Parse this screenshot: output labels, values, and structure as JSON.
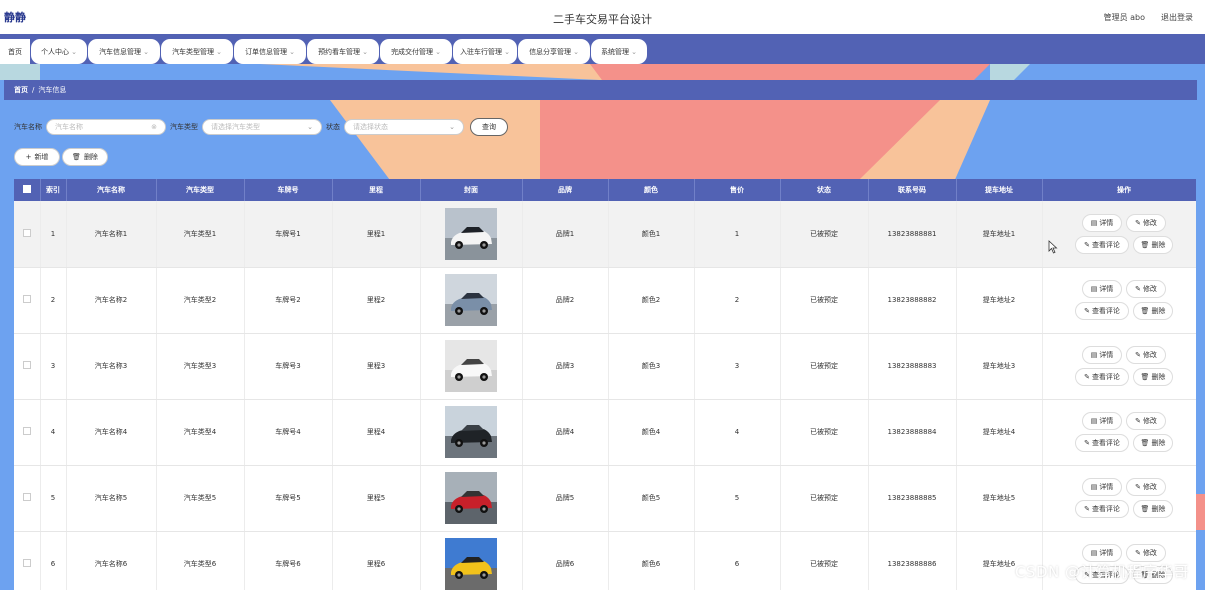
{
  "header": {
    "logo": "静静",
    "title": "二手车交易平台设计",
    "admin": "管理员 abo",
    "logout": "退出登录"
  },
  "nav": [
    {
      "label": "首页",
      "dropdown": false
    },
    {
      "label": "个人中心",
      "dropdown": true
    },
    {
      "label": "汽车信息管理",
      "dropdown": true
    },
    {
      "label": "汽车类型管理",
      "dropdown": true
    },
    {
      "label": "订单信息管理",
      "dropdown": true
    },
    {
      "label": "预约看车管理",
      "dropdown": true
    },
    {
      "label": "完成交付管理",
      "dropdown": true
    },
    {
      "label": "入驻车行管理",
      "dropdown": true
    },
    {
      "label": "信息分享管理",
      "dropdown": true
    },
    {
      "label": "系统管理",
      "dropdown": true
    }
  ],
  "breadcrumb": {
    "home": "首页",
    "separator": "/",
    "current": "汽车信息"
  },
  "search": {
    "car_name_label": "汽车名称",
    "car_name_placeholder": "汽车名称",
    "car_type_label": "汽车类型",
    "car_type_placeholder": "请选择汽车类型",
    "status_label": "状态",
    "status_placeholder": "请选择状态",
    "query_button": "查询"
  },
  "actions": {
    "add": "新增",
    "delete": "删除"
  },
  "table": {
    "headers": [
      "索引",
      "汽车名称",
      "汽车类型",
      "车牌号",
      "里程",
      "封面",
      "品牌",
      "颜色",
      "售价",
      "状态",
      "联系号码",
      "提车地址",
      "操作"
    ],
    "op_labels": {
      "detail": "详情",
      "edit": "修改",
      "comments": "查看评论",
      "delete": "删除"
    },
    "rows": [
      {
        "index": "1",
        "name": "汽车名称1",
        "type": "汽车类型1",
        "plate": "车牌号1",
        "mileage": "里程1",
        "brand": "品牌1",
        "color": "颜色1",
        "price": "1",
        "status": "已被预定",
        "phone": "13823888881",
        "address": "提车地址1",
        "cover": "white-sports-car"
      },
      {
        "index": "2",
        "name": "汽车名称2",
        "type": "汽车类型2",
        "plate": "车牌号2",
        "mileage": "里程2",
        "brand": "品牌2",
        "color": "颜色2",
        "price": "2",
        "status": "已被预定",
        "phone": "13823888882",
        "address": "提车地址2",
        "cover": "wrapped-sedan"
      },
      {
        "index": "3",
        "name": "汽车名称3",
        "type": "汽车类型3",
        "plate": "车牌号3",
        "mileage": "里程3",
        "brand": "品牌3",
        "color": "颜色3",
        "price": "3",
        "status": "已被预定",
        "phone": "13823888883",
        "address": "提车地址3",
        "cover": "white-roadster"
      },
      {
        "index": "4",
        "name": "汽车名称4",
        "type": "汽车类型4",
        "plate": "车牌号4",
        "mileage": "里程4",
        "brand": "品牌4",
        "color": "颜色4",
        "price": "4",
        "status": "已被预定",
        "phone": "13823888884",
        "address": "提车地址4",
        "cover": "black-suv"
      },
      {
        "index": "5",
        "name": "汽车名称5",
        "type": "汽车类型5",
        "plate": "车牌号5",
        "mileage": "里程5",
        "brand": "品牌5",
        "color": "颜色5",
        "price": "5",
        "status": "已被预定",
        "phone": "13823888885",
        "address": "提车地址5",
        "cover": "red-coupe"
      },
      {
        "index": "6",
        "name": "汽车名称6",
        "type": "汽车类型6",
        "plate": "车牌号6",
        "mileage": "里程6",
        "brand": "品牌6",
        "color": "颜色6",
        "price": "6",
        "status": "已被预定",
        "phone": "13823888886",
        "address": "提车地址6",
        "cover": "yellow-racer"
      }
    ]
  },
  "watermark": "CSDN @计算机程序华哥",
  "colors": {
    "primary": "#5262b4",
    "peach": "#f8c39a",
    "salmon": "#f4918a",
    "sky": "#6da2f0"
  }
}
